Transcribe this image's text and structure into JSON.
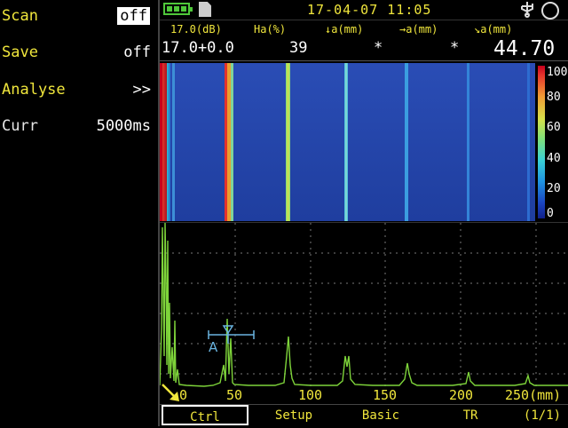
{
  "menu": {
    "items": [
      {
        "label": "Scan",
        "value": "off"
      },
      {
        "label": "Save",
        "value": "off"
      },
      {
        "label": "Analyse",
        "value": ">>"
      },
      {
        "label": "Curr",
        "value": "5000ms"
      }
    ]
  },
  "topbar": {
    "datetime": "17-04-07 11:05",
    "icons": [
      "battery-icon",
      "sd-card-icon",
      "usb-icon",
      "circle-icon"
    ]
  },
  "readout": {
    "headers": [
      "17.0(dB)",
      "Ha(%)",
      "↓a(mm)",
      "→a(mm)",
      "↘a(mm)"
    ],
    "values": [
      "17.0+0.0",
      "39",
      "*",
      "*",
      "44.70"
    ]
  },
  "color_scale": {
    "ticks": [
      "100",
      "80",
      "60",
      "40",
      "20",
      "0"
    ]
  },
  "ascan": {
    "gate_label": "A",
    "x_ticks": [
      "0",
      "50",
      "100",
      "150",
      "200",
      "250(mm)"
    ]
  },
  "tabs": {
    "items": [
      "Ctrl",
      "Setup",
      "Basic",
      "TR",
      "(1/1)"
    ],
    "active": "Ctrl"
  },
  "colors": {
    "accent": "#f0e63c",
    "trace": "#7ed43a",
    "gate": "#6ab4e0"
  }
}
